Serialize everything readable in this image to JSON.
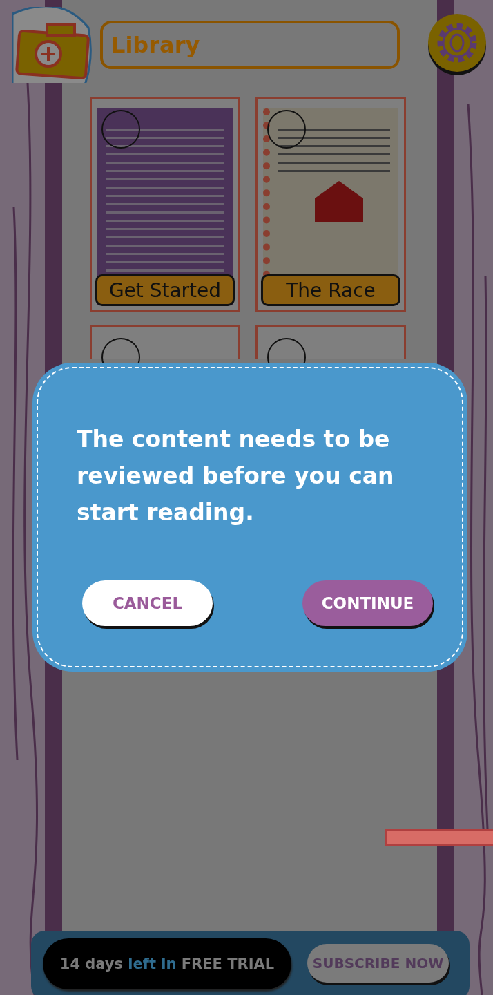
{
  "header": {
    "title": "Library"
  },
  "books": [
    {
      "kind": "guide",
      "title": "Get Started"
    },
    {
      "kind": "notebook",
      "title": "The Race"
    },
    {
      "kind": "empty"
    },
    {
      "kind": "empty"
    }
  ],
  "dialog": {
    "message": "The content needs to be reviewed before you can start reading.",
    "buttons": [
      {
        "label": "CANCEL",
        "kind": "secondary"
      },
      {
        "label": "CONTINUE",
        "kind": "primary"
      }
    ]
  },
  "trial": {
    "parts": [
      "14 days",
      "left in",
      "FREE TRIAL"
    ]
  },
  "subscribe": {
    "label": "SUBSCRIBE NOW"
  }
}
